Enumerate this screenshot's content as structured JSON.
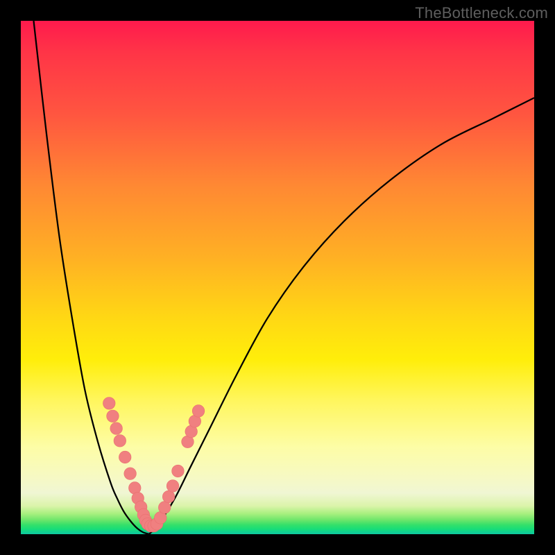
{
  "watermark": "TheBottleneck.com",
  "colors": {
    "background": "#000000",
    "curve": "#000000",
    "marker_fill": "#f08080",
    "marker_stroke": "#e86f6f"
  },
  "chart_data": {
    "type": "line",
    "title": "",
    "xlabel": "",
    "ylabel": "",
    "xlim": [
      0,
      100
    ],
    "ylim": [
      0,
      100
    ],
    "grid": false,
    "series": [
      {
        "name": "left-branch",
        "x": [
          2.5,
          5,
          7.5,
          10,
          12.5,
          15,
          17.5,
          18.75,
          20,
          21.25,
          22.5,
          23.75,
          25
        ],
        "values": [
          100,
          78,
          58,
          42,
          28,
          18,
          10,
          7,
          4.5,
          2.7,
          1.3,
          0.4,
          0
        ]
      },
      {
        "name": "right-branch",
        "x": [
          25,
          27,
          30,
          33,
          37,
          42,
          48,
          55,
          63,
          72,
          82,
          92,
          100
        ],
        "values": [
          0,
          2.2,
          7,
          13,
          21,
          31,
          42,
          52,
          61,
          69,
          76,
          81,
          85
        ]
      }
    ],
    "markers": [
      {
        "x": 17.2,
        "y": 25.5
      },
      {
        "x": 17.9,
        "y": 23.0
      },
      {
        "x": 18.6,
        "y": 20.6
      },
      {
        "x": 19.3,
        "y": 18.2
      },
      {
        "x": 20.3,
        "y": 15.0
      },
      {
        "x": 21.3,
        "y": 11.8
      },
      {
        "x": 22.2,
        "y": 9.0
      },
      {
        "x": 22.8,
        "y": 7.0
      },
      {
        "x": 23.4,
        "y": 5.3
      },
      {
        "x": 23.9,
        "y": 3.8
      },
      {
        "x": 24.3,
        "y": 2.7
      },
      {
        "x": 24.7,
        "y": 2.0
      },
      {
        "x": 25.3,
        "y": 1.6
      },
      {
        "x": 25.9,
        "y": 1.6
      },
      {
        "x": 26.5,
        "y": 2.0
      },
      {
        "x": 27.2,
        "y": 3.2
      },
      {
        "x": 28.0,
        "y": 5.2
      },
      {
        "x": 28.8,
        "y": 7.3
      },
      {
        "x": 29.6,
        "y": 9.4
      },
      {
        "x": 30.6,
        "y": 12.3
      },
      {
        "x": 32.5,
        "y": 18.0
      },
      {
        "x": 33.2,
        "y": 20.0
      },
      {
        "x": 33.9,
        "y": 22.0
      },
      {
        "x": 34.6,
        "y": 24.0
      }
    ]
  }
}
